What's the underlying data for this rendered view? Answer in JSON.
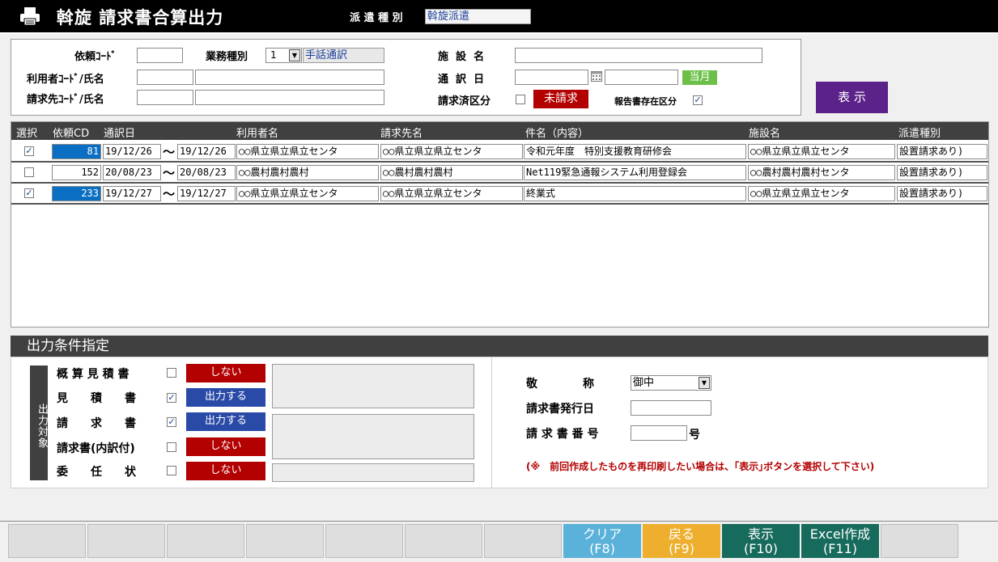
{
  "header": {
    "title": "斡旋 請求書合算出力",
    "dispatch_label": "派 遣 種 別",
    "dispatch_value": "斡旋派遣"
  },
  "search": {
    "request_code_label": "依頼ｺｰﾄﾞ",
    "request_code_value": "",
    "business_type_label": "業務種別",
    "business_type_code": "1",
    "business_type_name": "手話通訳",
    "user_label": "利用者ｺｰﾄﾞ/氏名",
    "user_code": "",
    "user_name": "",
    "billing_label": "請求先ｺｰﾄﾞ/氏名",
    "billing_code": "",
    "billing_name": "",
    "facility_label": "施  設  名",
    "facility_value": "",
    "date_label": "通  訳  日",
    "date_from": "",
    "date_to": "",
    "current_month_button": "当月",
    "billed_label": "請求済区分",
    "billed_checked": false,
    "unbilled_button": "未請求",
    "report_label": "報告書存在区分",
    "report_checked": true,
    "display_button": "表 示"
  },
  "grid": {
    "columns": [
      "選択",
      "依頼CD",
      "通訳日",
      "利用者名",
      "請求先名",
      "件名（内容）",
      "施設名",
      "派遣種別"
    ],
    "rows": [
      {
        "checked": true,
        "cd": "81",
        "date_from": "19/12/26",
        "tilde": "〜",
        "date_to": "19/12/26",
        "user": "○○県立県立県立センタ",
        "billing": "○○県立県立県立センタ",
        "subject": "令和元年度　特別支援教育研修会",
        "facility": "○○県立県立県立センタ",
        "type": "設置請求あり)",
        "selected": true
      },
      {
        "checked": false,
        "cd": "152",
        "date_from": "20/08/23",
        "tilde": "〜",
        "date_to": "20/08/23",
        "user": "○○農村農村農村",
        "billing": "○○農村農村農村",
        "subject": "Net119緊急通報システム利用登録会",
        "facility": "○○農村農村農村センタ",
        "type": "設置請求あり)",
        "selected": false
      },
      {
        "checked": true,
        "cd": "233",
        "date_from": "19/12/27",
        "tilde": "〜",
        "date_to": "19/12/27",
        "user": "○○県立県立県立センタ",
        "billing": "○○県立県立県立センタ",
        "subject": "終業式",
        "facility": "○○県立県立県立センタ",
        "type": "設置請求あり)",
        "selected": true
      }
    ]
  },
  "output": {
    "section_title": "出力条件指定",
    "target_label": "出力対象",
    "items": [
      {
        "label": "概 算 見 積 書",
        "checked": false,
        "button": "しない",
        "state": "off"
      },
      {
        "label": "見　　積　　書",
        "checked": true,
        "button": "出力する",
        "state": "on"
      },
      {
        "label": "請　　求　　書",
        "checked": true,
        "button": "出力する",
        "state": "on"
      },
      {
        "label": "請求書(内訳付)",
        "checked": false,
        "button": "しない",
        "state": "off"
      },
      {
        "label": "委　　任　　状",
        "checked": false,
        "button": "しない",
        "state": "off"
      }
    ],
    "honorific_label": "敬　　　　称",
    "honorific_value": "御中",
    "issue_date_label": "請求書発行日",
    "issue_date_value": "",
    "invoice_no_label": "請 求 書 番 号",
    "invoice_no_value": "",
    "invoice_no_suffix": "号",
    "note": "(※　前回作成したものを再印刷したい場合は、｢表示｣ボタンを選択して下さい)"
  },
  "footer": {
    "keys": [
      {
        "label": "",
        "sub": "",
        "color": ""
      },
      {
        "label": "",
        "sub": "",
        "color": ""
      },
      {
        "label": "",
        "sub": "",
        "color": ""
      },
      {
        "label": "",
        "sub": "",
        "color": ""
      },
      {
        "label": "",
        "sub": "",
        "color": ""
      },
      {
        "label": "",
        "sub": "",
        "color": ""
      },
      {
        "label": "",
        "sub": "",
        "color": ""
      },
      {
        "label": "クリア",
        "sub": "(F8)",
        "color": "#5ab1d9"
      },
      {
        "label": "戻る",
        "sub": "(F9)",
        "color": "#eeaf2e"
      },
      {
        "label": "表示",
        "sub": "(F10)",
        "color": "#176b5c"
      },
      {
        "label": "Excel作成",
        "sub": "(F11)",
        "color": "#176b5c"
      },
      {
        "label": "",
        "sub": "",
        "color": ""
      }
    ]
  },
  "colors": {
    "accent_red": "#b30000",
    "accent_blue": "#2a4aa8",
    "accent_purple": "#5b2289",
    "current_month_green": "#6cc04a",
    "selected_cell": "#0a6fc2"
  }
}
